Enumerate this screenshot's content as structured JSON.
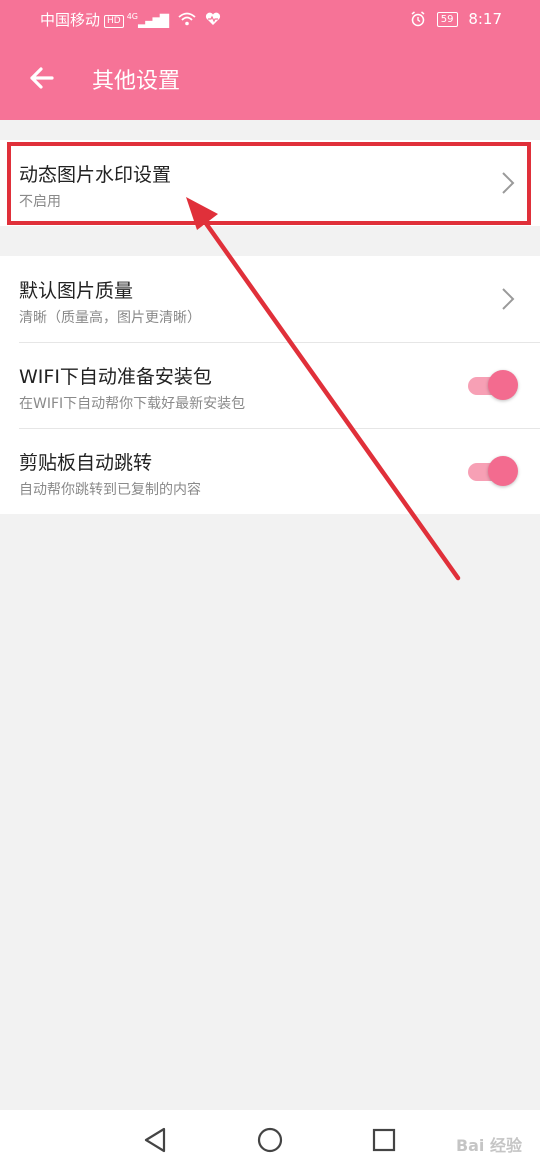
{
  "status_bar": {
    "carrier": "中国移动",
    "hd": "HD",
    "network": "4G",
    "battery": "59",
    "time": "8:17"
  },
  "header": {
    "title": "其他设置",
    "back_icon": "arrow-left-icon"
  },
  "settings": [
    {
      "title": "动态图片水印设置",
      "subtitle": "不启用",
      "control": "chevron"
    },
    {
      "title": "默认图片质量",
      "subtitle": "清晰（质量高，图片更清晰）",
      "control": "chevron"
    },
    {
      "title": "WIFI下自动准备安装包",
      "subtitle": "在WIFI下自动帮你下载好最新安装包",
      "control": "toggle",
      "on": true
    },
    {
      "title": "剪贴板自动跳转",
      "subtitle": "自动帮你跳转到已复制的内容",
      "control": "toggle",
      "on": true
    }
  ],
  "nav": {
    "back": "triangle-back-icon",
    "home": "circle-home-icon",
    "recents": "square-recents-icon"
  },
  "watermark": "Bai 经验",
  "colors": {
    "header": "#f67397",
    "toggle_on": "#f36b8f",
    "highlight": "#e0303a"
  }
}
